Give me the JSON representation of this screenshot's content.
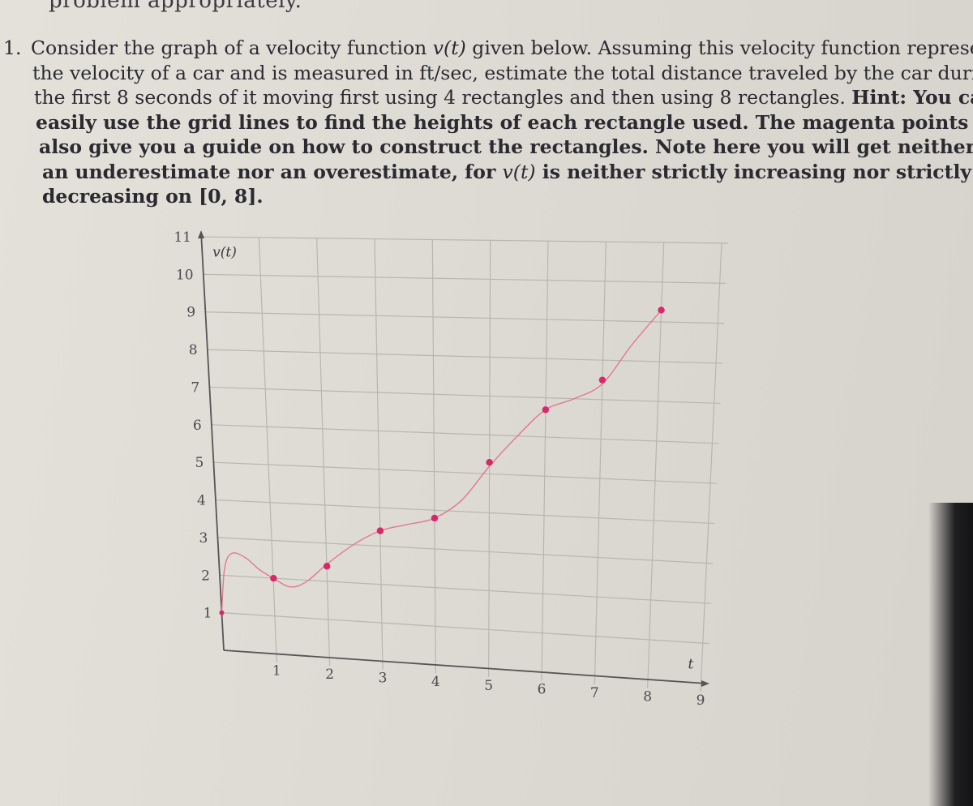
{
  "header": {
    "cut_off_text": "problem appropriately."
  },
  "problem": {
    "number": "1.",
    "lines": [
      {
        "parts": [
          {
            "t": "Consider the graph of a velocity function "
          },
          {
            "t": "v(t)",
            "style": "it"
          },
          {
            "t": " given below. Assuming this velocity function represents"
          }
        ]
      },
      {
        "parts": [
          {
            "t": "the velocity of a car and is measured in ft/sec, estimate the total distance traveled by the car during"
          }
        ]
      },
      {
        "parts": [
          {
            "t": "the first 8 seconds of it moving first using 4 rectangles and then using 8 rectangles. "
          },
          {
            "t": "Hint: You can",
            "style": "b"
          }
        ]
      },
      {
        "parts": [
          {
            "t": "easily use the grid lines to find the heights of each rectangle used. The magenta points will",
            "style": "b"
          }
        ]
      },
      {
        "parts": [
          {
            "t": "also give you a guide on how to construct the rectangles. Note here you will get neither",
            "style": "b"
          }
        ]
      },
      {
        "parts": [
          {
            "t": "an underestimate nor an overestimate, for ",
            "style": "b"
          },
          {
            "t": "v(t)",
            "style": "it"
          },
          {
            "t": " is neither strictly increasing nor strictly",
            "style": "b"
          }
        ]
      },
      {
        "parts": [
          {
            "t": "decreasing on ",
            "style": "b"
          },
          {
            "t": "[0, 8].",
            "style": "b"
          }
        ]
      }
    ]
  },
  "chart_data": {
    "type": "line",
    "title": "",
    "xlabel": "t",
    "ylabel": "v(t)",
    "xlim": [
      0,
      9
    ],
    "ylim": [
      0,
      11
    ],
    "grid": true,
    "xticks": [
      "1",
      "2",
      "3",
      "4",
      "5",
      "6",
      "7",
      "8",
      "9"
    ],
    "yticks": [
      "1",
      "2",
      "3",
      "4",
      "5",
      "6",
      "7",
      "8",
      "9",
      "10",
      "11"
    ],
    "curve_color": "#e07a8a",
    "point_color": "#d6286a",
    "curve": {
      "x": [
        0,
        0.1,
        0.25,
        0.5,
        0.75,
        1,
        1.3,
        1.6,
        2,
        2.5,
        3,
        3.5,
        4,
        4.5,
        5,
        5.5,
        6,
        6.5,
        7,
        7.5,
        8
      ],
      "y": [
        1.0,
        2.2,
        2.6,
        2.5,
        2.2,
        2.0,
        1.8,
        1.95,
        2.45,
        3.0,
        3.4,
        3.6,
        3.8,
        4.3,
        5.2,
        6.0,
        6.7,
        7.0,
        7.4,
        8.4,
        9.3
      ]
    },
    "marked_points": {
      "x": [
        0,
        1,
        2,
        3,
        4,
        5,
        6,
        7,
        8
      ],
      "y": [
        1,
        2,
        2.4,
        3.4,
        3.8,
        5.3,
        6.7,
        7.5,
        9.3
      ]
    }
  }
}
